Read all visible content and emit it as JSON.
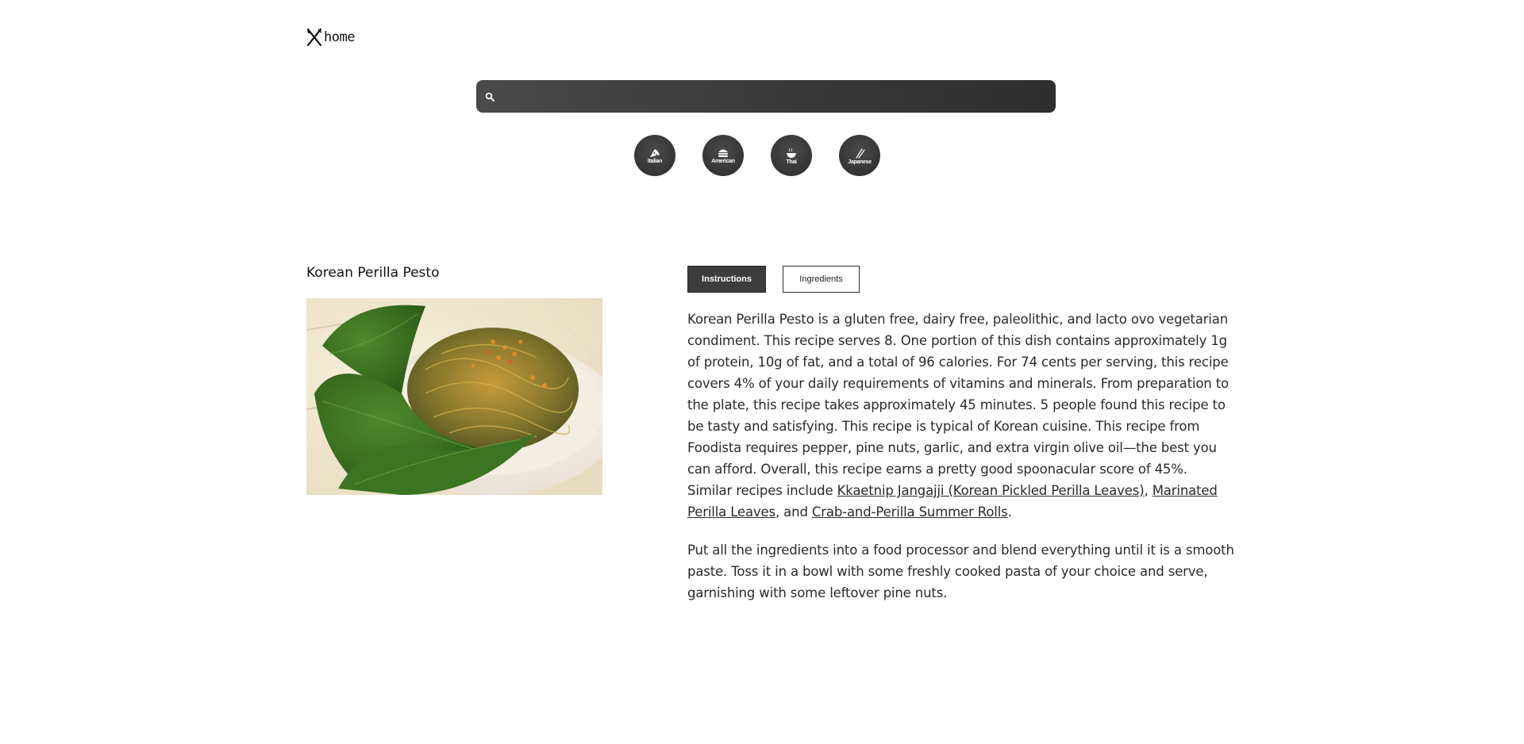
{
  "header": {
    "logo_text": "home"
  },
  "search": {
    "placeholder": "",
    "value": ""
  },
  "categories": [
    {
      "label": "Italian",
      "icon": "pizza-icon"
    },
    {
      "label": "American",
      "icon": "burger-icon"
    },
    {
      "label": "Thai",
      "icon": "noodle-bowl-icon"
    },
    {
      "label": "Japanese",
      "icon": "chopsticks-icon"
    }
  ],
  "recipe": {
    "title": "Korean Perilla Pesto",
    "image_alt": "Korean Perilla Pesto"
  },
  "tabs": {
    "instructions": "Instructions",
    "ingredients": "Ingredients",
    "active": "instructions"
  },
  "summary": {
    "text_before_links": "Korean Perilla Pesto is a gluten free, dairy free, paleolithic, and lacto ovo vegetarian condiment. This recipe serves 8. One portion of this dish contains approximately 1g of protein, 10g of fat, and a total of 96 calories. For 74 cents per serving, this recipe covers 4% of your daily requirements of vitamins and minerals. From preparation to the plate, this recipe takes approximately 45 minutes. 5 people found this recipe to be tasty and satisfying. This recipe is typical of Korean cuisine. This recipe from Foodista requires pepper, pine nuts, garlic, and extra virgin olive oil—the best you can afford. Overall, this recipe earns a pretty good spoonacular score of 45%. Similar recipes include ",
    "link1": "Kkaetnip Jangajji (Korean Pickled Perilla Leaves)",
    "sep1": ", ",
    "link2": "Marinated Perilla Leaves",
    "sep2": ", and ",
    "link3": "Crab-and-Perilla Summer Rolls",
    "end": "."
  },
  "instructions": {
    "text": "Put all the ingredients into a food processor and blend everything until it is a smooth paste. Toss it in a bowl with some freshly cooked pasta of your choice and serve, garnishing with some leftover pine nuts."
  },
  "colors": {
    "dark": "#3d3d3d",
    "text": "#2a2a2a",
    "background": "#ffffff"
  }
}
